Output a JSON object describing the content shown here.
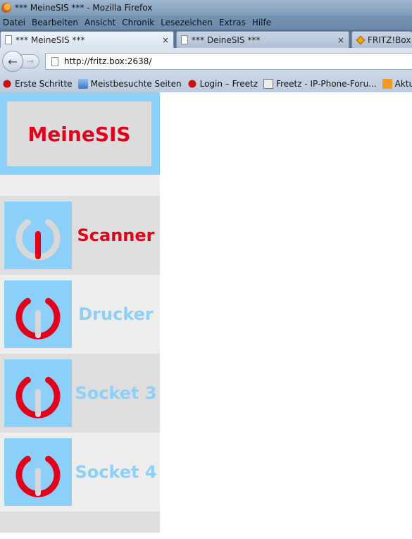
{
  "window": {
    "title": "*** MeineSIS *** - Mozilla Firefox"
  },
  "menu": [
    "Datei",
    "Bearbeiten",
    "Ansicht",
    "Chronik",
    "Lesezeichen",
    "Extras",
    "Hilfe"
  ],
  "menu_accel": [
    "D",
    "B",
    "A",
    "C",
    "L",
    "E",
    "H"
  ],
  "tabs": [
    {
      "label": "*** MeineSIS ***",
      "close": "×"
    },
    {
      "label": "*** DeineSIS ***",
      "close": "×"
    },
    {
      "label": "FRITZ!Box"
    }
  ],
  "nav": {
    "back": "←",
    "forward": "→",
    "url": "http://fritz.box:2638/"
  },
  "bookmarks": [
    {
      "label": "Erste Schritte",
      "icon": "firefox-red-icon"
    },
    {
      "label": "Meistbesuchte Seiten",
      "icon": "magnifier-icon"
    },
    {
      "label": "Login – Freetz",
      "icon": "freetz-icon"
    },
    {
      "label": "Freetz - IP-Phone-Foru...",
      "icon": "ipf-icon"
    },
    {
      "label": "Aktuelle Nach",
      "icon": "rss-icon"
    }
  ],
  "page": {
    "brand": "MeineSIS",
    "sockets": [
      {
        "label": "Scanner",
        "state": "on"
      },
      {
        "label": "Drucker",
        "state": "off"
      },
      {
        "label": "Socket 3",
        "state": "off"
      },
      {
        "label": "Socket 4",
        "state": "off"
      }
    ]
  },
  "colors": {
    "brand_red": "#e2001a",
    "light_blue": "#8ccff9",
    "power_off_ring": "#d8d8d8"
  }
}
